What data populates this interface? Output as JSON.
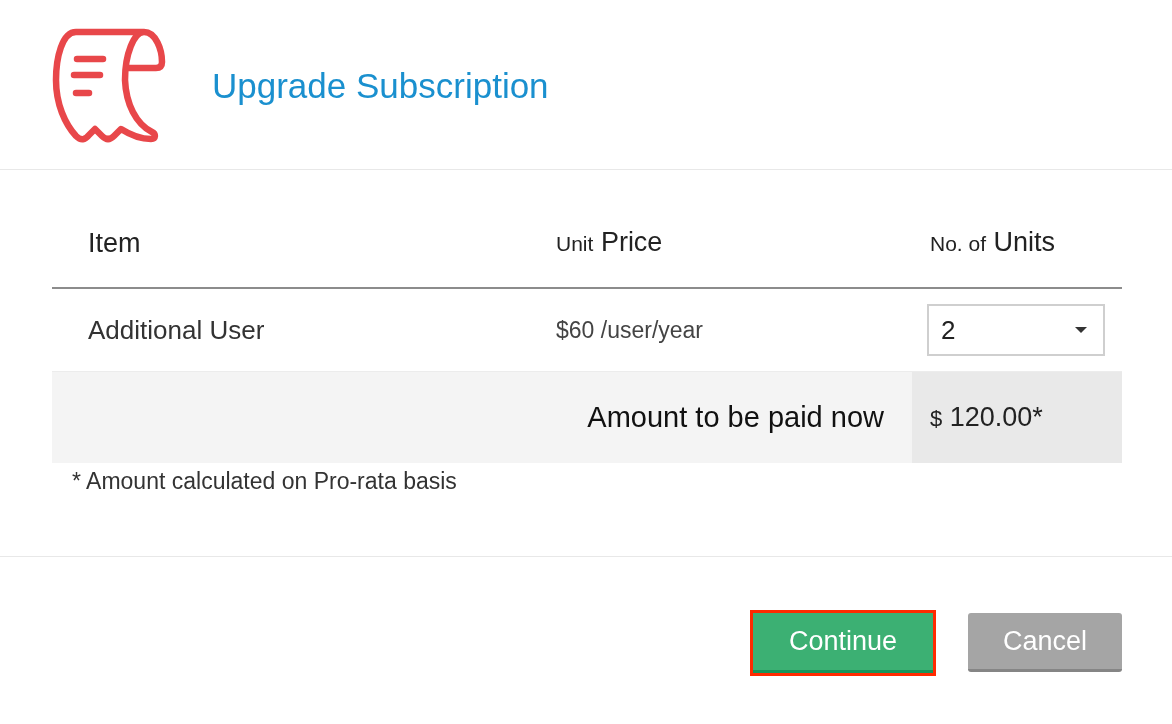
{
  "dialog": {
    "title": "Upgrade Subscription"
  },
  "table": {
    "columns": [
      {
        "label": "Item"
      },
      {
        "prefix": "Unit",
        "label": "Price"
      },
      {
        "prefix": "No. of",
        "label": "Units"
      }
    ],
    "rows": [
      {
        "item": "Additional User",
        "unit_price": "$60 /user/year",
        "units": "2"
      }
    ],
    "total": {
      "label": "Amount to be paid now",
      "currency": "$",
      "amount": "120.00*"
    }
  },
  "footnote": "* Amount calculated on Pro-rata basis",
  "buttons": [
    {
      "label": "Continue",
      "kind": "primary",
      "highlighted": true
    },
    {
      "label": "Cancel",
      "kind": "secondary",
      "highlighted": false
    }
  ]
}
